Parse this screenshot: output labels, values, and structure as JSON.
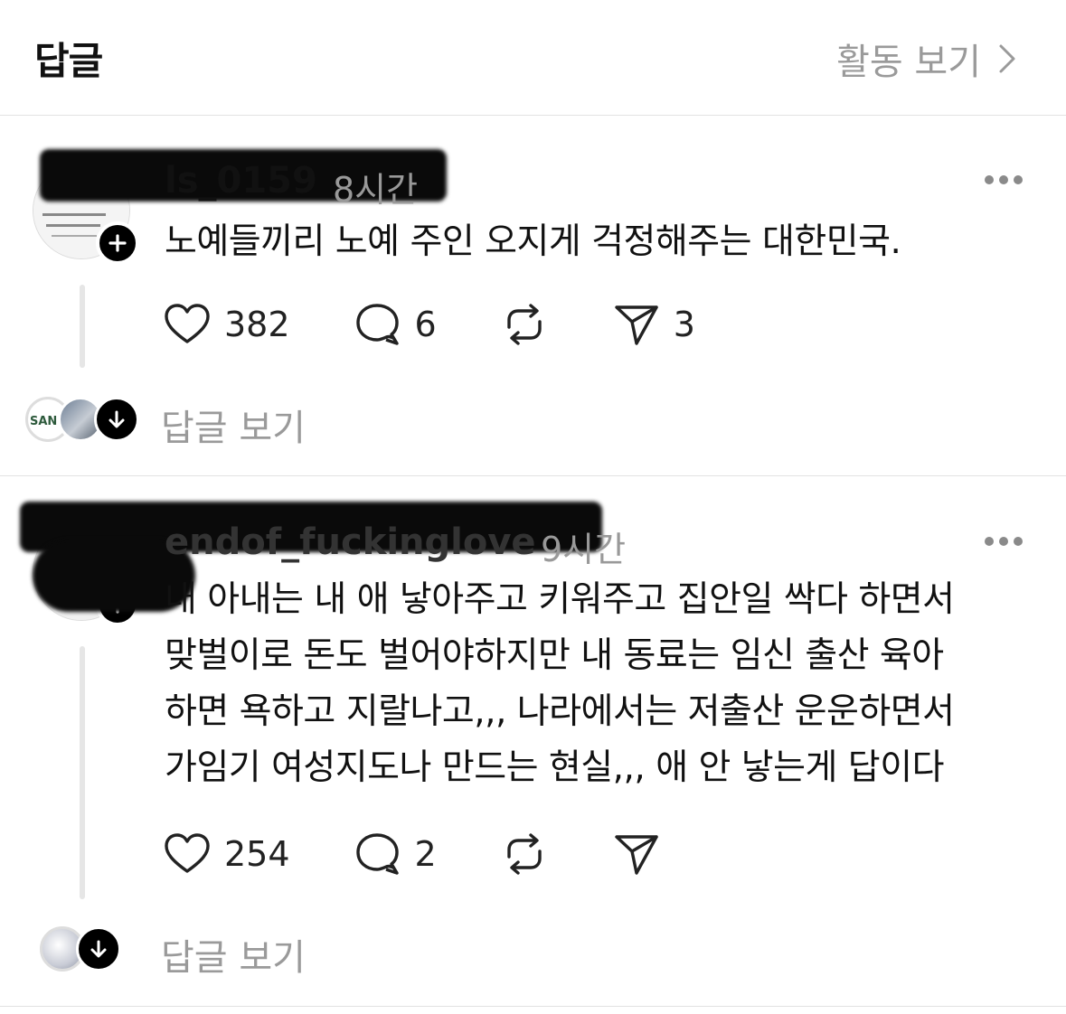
{
  "header": {
    "title": "답글",
    "activity_link": "활동 보기"
  },
  "comments": [
    {
      "username": "ls_0159",
      "time": "8시간",
      "text": "노예들끼리 노예 주인 오지게 걱정해주는 대한민국.",
      "likes": "382",
      "replies": "6",
      "shares": "3",
      "view_replies": "답글 보기",
      "mini_avatar_text": "SAN"
    },
    {
      "username": "endof_fuckinglove",
      "time": "9시간",
      "text_lines": [
        "내 아내는 내 애 낳아주고 키워주고 집안일 싹다 하면서",
        "맞벌이로 돈도 벌어야하지만 내 동료는 임신 출산 육아",
        "하면 욕하고 지랄나고,,, 나라에서는 저출산 운운하면서",
        "가임기 여성지도나 만드는 현실,,, 애 안 낳는게 답이다"
      ],
      "likes": "254",
      "replies": "2",
      "view_replies": "답글 보기"
    }
  ]
}
